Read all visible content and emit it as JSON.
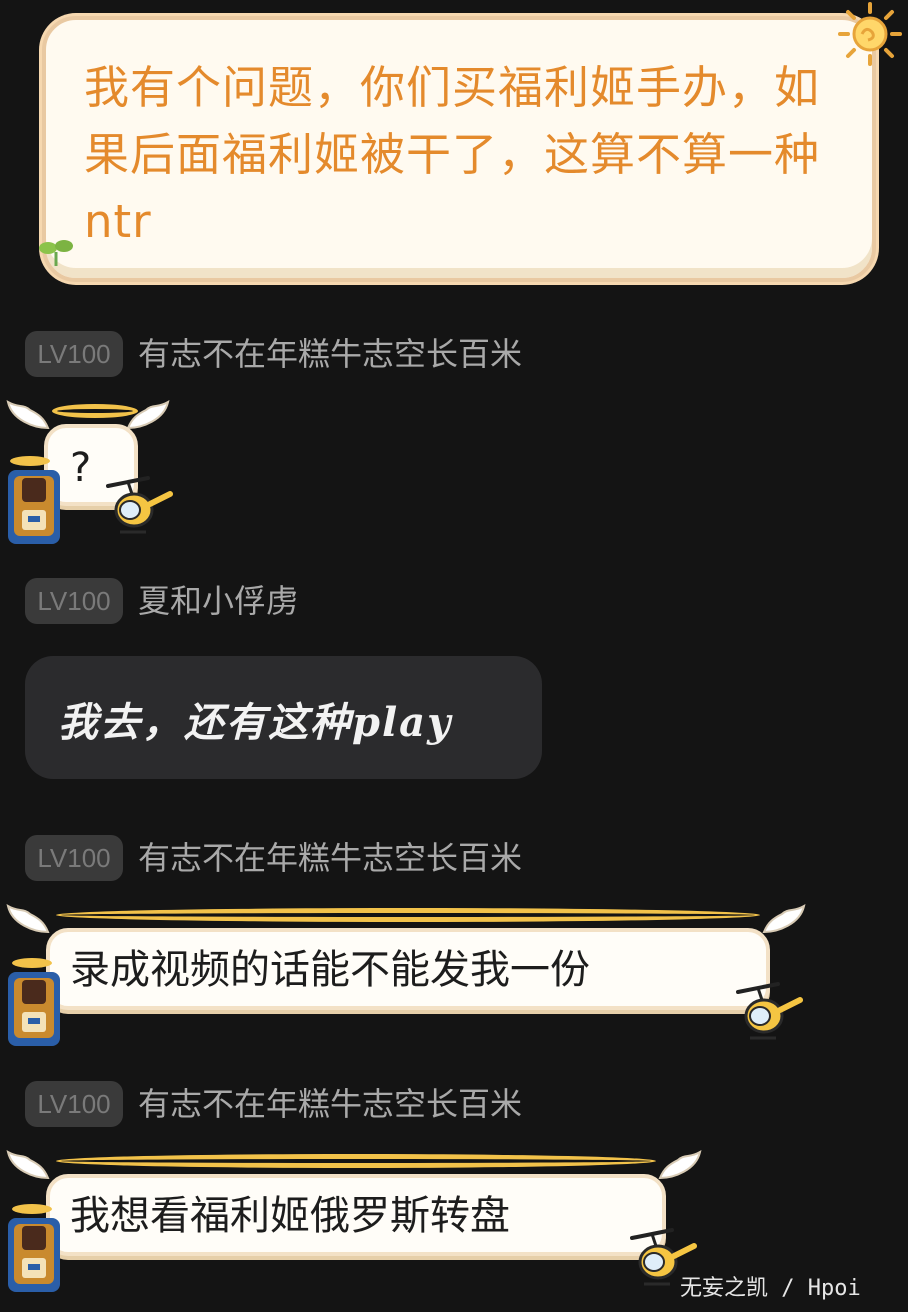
{
  "quote": {
    "text": "我有个问题，你们买福利姬手办，如果后面福利姬被干了，这算不算一种ntr"
  },
  "messages": [
    {
      "level": "LV100",
      "username": "有志不在年糕牛志空长百米",
      "text": "?"
    },
    {
      "level": "LV100",
      "username": "夏和小俘虏",
      "text": "我去，还有这种play"
    },
    {
      "level": "LV100",
      "username": "有志不在年糕牛志空长百米",
      "text": "录成视频的话能不能发我一份"
    },
    {
      "level": "LV100",
      "username": "有志不在年糕牛志空长百米",
      "text": "我想看福利姬俄罗斯转盘"
    }
  ],
  "watermark": "无妄之凯 / Hpoi",
  "colors": {
    "background": "#141414",
    "quote_text": "#e48a2c",
    "halo": "#f2c24a",
    "badge_bg": "#3a3a3a"
  },
  "icons": [
    "sun-icon",
    "sprout-icon",
    "wing-icon",
    "avatar-icon",
    "helicopter-icon",
    "halo-icon"
  ]
}
